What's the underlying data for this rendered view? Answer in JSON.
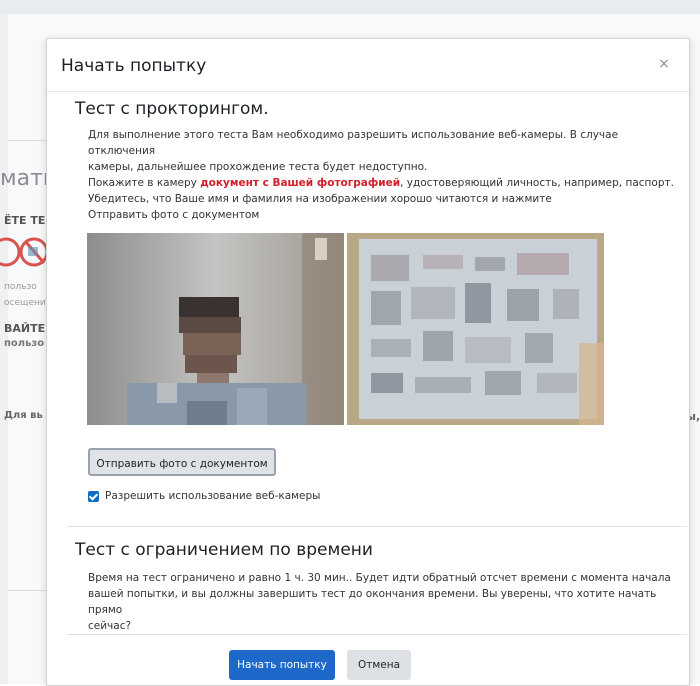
{
  "background": {
    "heading_fragment": "мати",
    "bold_fragment_1": "ЁТЕ ТЕ",
    "small_fragment_1": "пользо",
    "small_fragment_2": "осещени",
    "bold_fragment_2": "ВАЙТЕ",
    "bold_fragment_3": "пользо",
    "bold_fragment_4": "Для вь",
    "right_fragment": "ы,"
  },
  "modal": {
    "title": "Начать попытку",
    "close_label": "×",
    "proctoring": {
      "title": "Тест с прокторингом.",
      "line1": "Для выполнение этого теста Вам необходимо разрешить использование веб-камеры. В случае отключения",
      "line2": "камеры, дальнейшее прохождение теста будет недоступно.",
      "line3_prefix": "Покажите в камеру ",
      "line3_highlight": "документ с Вашей фотографией",
      "line3_suffix": ", удостоверяющий личность, например, паспорт.",
      "line4": "Убедитесь, что Ваше имя и фамилия на изображении хорошо читаются и нажмите",
      "line5": "Отправить фото с документом",
      "send_button": "Отправить фото с документом",
      "webcam_checkbox_label": "Разрешить использование веб-камеры",
      "webcam_checkbox_checked": true
    },
    "time_limit": {
      "title": "Тест с ограничением по времени",
      "line1": "Время на тест ограничено и равно 1 ч. 30 мин.. Будет идти обратный отсчет времени с момента начала",
      "line2": "вашей попытки, и вы должны завершить тест до окончания времени. Вы уверены, что хотите начать прямо",
      "line3": "сейчас?"
    },
    "start_button": "Начать попытку",
    "cancel_button": "Отмена"
  },
  "colors": {
    "primary": "#1d68c9",
    "highlight_red": "#d21f2a",
    "checkbox": "#0f6cbf"
  }
}
